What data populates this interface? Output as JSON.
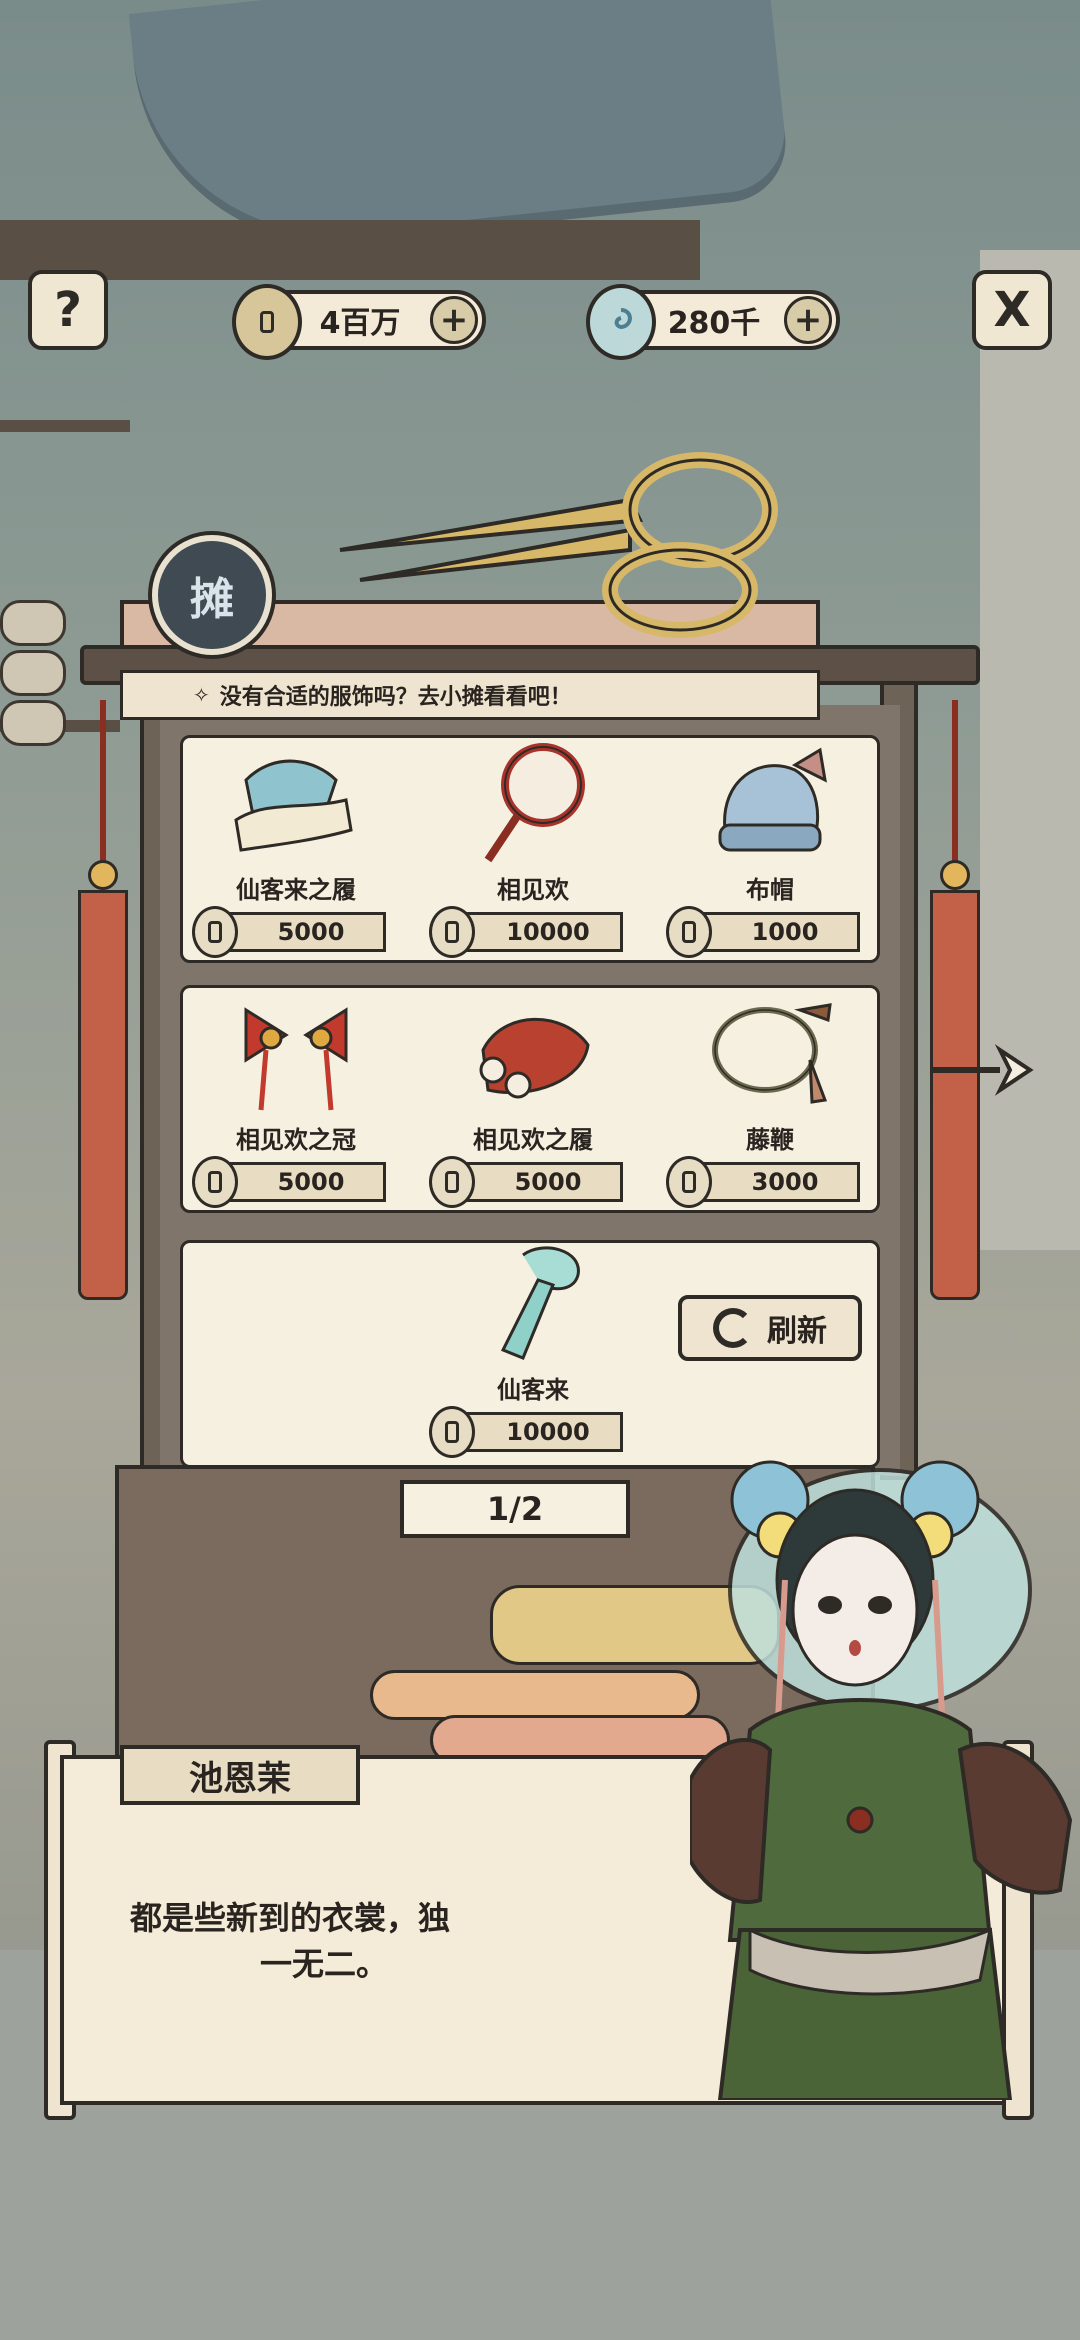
{
  "top_bar": {
    "help_icon": "?",
    "close_icon": "X",
    "coins": {
      "value": "4百万",
      "plus": "+"
    },
    "jade": {
      "value": "280千",
      "plus": "+"
    }
  },
  "stall": {
    "badge_text": "摊",
    "tip_text": "没有合适的服饰吗？去小摊看看吧！"
  },
  "items": [
    {
      "name": "仙客来之履",
      "price": "5000",
      "icon": "shoes-icon"
    },
    {
      "name": "相见欢",
      "price": "10000",
      "icon": "hand-drum-icon"
    },
    {
      "name": "布帽",
      "price": "1000",
      "icon": "cloth-hat-icon"
    },
    {
      "name": "相见欢之冠",
      "price": "5000",
      "icon": "bow-crown-icon"
    },
    {
      "name": "相见欢之履",
      "price": "5000",
      "icon": "red-shoes-icon"
    },
    {
      "name": "藤鞭",
      "price": "3000",
      "icon": "whip-icon"
    },
    {
      "name": "仙客来",
      "price": "10000",
      "icon": "scepter-icon"
    }
  ],
  "refresh_label": "刷新",
  "pagination": "1/2",
  "dialog": {
    "speaker": "池恩茉",
    "line1": "都是些新到的衣裳，独",
    "line2": "一无二。"
  },
  "colors": {
    "paper": "#f6f0e1",
    "ink": "#2e2a26",
    "wood": "#6e6357",
    "tassel": "#c26148"
  }
}
